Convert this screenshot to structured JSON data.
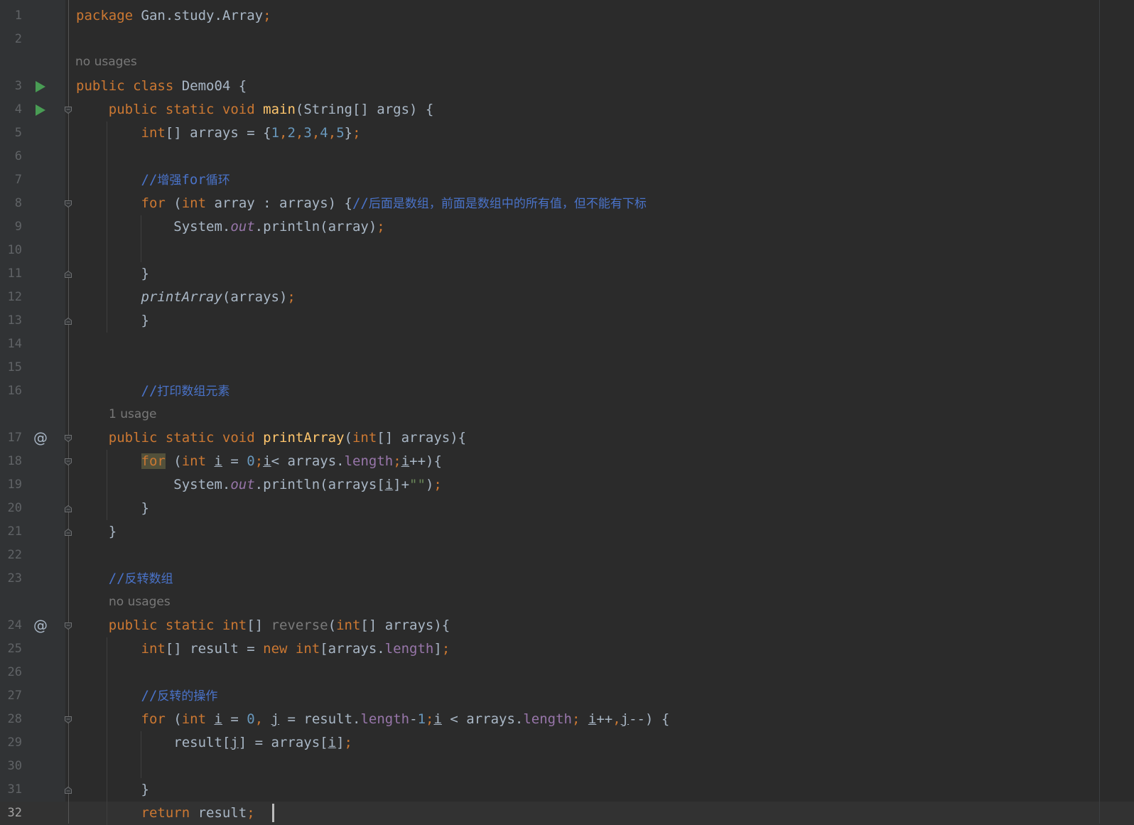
{
  "lines": [
    {
      "n": "1",
      "tokens": [
        {
          "t": "package",
          "c": "kw"
        },
        {
          "t": " Gan.study.Array"
        },
        {
          "t": ";",
          "c": "kw"
        }
      ]
    },
    {
      "n": "2",
      "tokens": []
    },
    {
      "n": "3",
      "tokens": [
        {
          "t": "public class",
          "c": "kw"
        },
        {
          "t": " Demo04 {"
        }
      ]
    },
    {
      "n": "4",
      "tokens": [
        {
          "t": "    public static void",
          "c": "kw"
        },
        {
          "t": " "
        },
        {
          "t": "main",
          "c": "fn"
        },
        {
          "t": "(String[] args) {"
        }
      ]
    },
    {
      "n": "5",
      "tokens": [
        {
          "t": "        int",
          "c": "kw"
        },
        {
          "t": "[] arrays = {"
        },
        {
          "t": "1",
          "c": "num"
        },
        {
          "t": ",",
          "c": "kw"
        },
        {
          "t": "2",
          "c": "num"
        },
        {
          "t": ",",
          "c": "kw"
        },
        {
          "t": "3",
          "c": "num"
        },
        {
          "t": ",",
          "c": "kw"
        },
        {
          "t": "4",
          "c": "num"
        },
        {
          "t": ",",
          "c": "kw"
        },
        {
          "t": "5",
          "c": "num"
        },
        {
          "t": "}"
        },
        {
          "t": ";",
          "c": "kw"
        }
      ]
    },
    {
      "n": "6",
      "tokens": []
    },
    {
      "n": "7",
      "tokens": [
        {
          "t": "        //",
          "c": "cm"
        },
        {
          "t": "增强",
          "c": "cm cm-cjk"
        },
        {
          "t": "for",
          "c": "cm"
        },
        {
          "t": "循环",
          "c": "cm cm-cjk"
        }
      ]
    },
    {
      "n": "8",
      "tokens": [
        {
          "t": "        for",
          "c": "kw"
        },
        {
          "t": " ("
        },
        {
          "t": "int",
          "c": "kw"
        },
        {
          "t": " array : arrays) {"
        },
        {
          "t": "//",
          "c": "cm"
        },
        {
          "t": "后面是数组，前面是数组中的所有值，但不能有下标",
          "c": "cm cm-cjk"
        }
      ]
    },
    {
      "n": "9",
      "tokens": [
        {
          "t": "            System."
        },
        {
          "t": "out",
          "c": "sfld"
        },
        {
          "t": ".println(array)"
        },
        {
          "t": ";",
          "c": "kw"
        }
      ]
    },
    {
      "n": "10",
      "tokens": []
    },
    {
      "n": "11",
      "tokens": [
        {
          "t": "        }"
        }
      ]
    },
    {
      "n": "12",
      "tokens": [
        {
          "t": "        "
        },
        {
          "t": "printArray",
          "c": "ital"
        },
        {
          "t": "(arrays)"
        },
        {
          "t": ";",
          "c": "kw"
        }
      ]
    },
    {
      "n": "13",
      "tokens": [
        {
          "t": "        }"
        }
      ]
    },
    {
      "n": "14",
      "tokens": []
    },
    {
      "n": "15",
      "tokens": []
    },
    {
      "n": "16",
      "tokens": [
        {
          "t": "        //",
          "c": "cm"
        },
        {
          "t": "打印数组元素",
          "c": "cm cm-cjk"
        }
      ],
      "hint_after": "1 usage"
    },
    {
      "n": "17",
      "tokens": [
        {
          "t": "    public static void",
          "c": "kw"
        },
        {
          "t": " "
        },
        {
          "t": "printArray",
          "c": "fn"
        },
        {
          "t": "("
        },
        {
          "t": "int",
          "c": "kw"
        },
        {
          "t": "[] arrays){"
        }
      ]
    },
    {
      "n": "18",
      "tokens": [
        {
          "t": "        "
        },
        {
          "t": "for",
          "c": "kw hl"
        },
        {
          "t": " ("
        },
        {
          "t": "int",
          "c": "kw"
        },
        {
          "t": " "
        },
        {
          "t": "i",
          "c": "ul"
        },
        {
          "t": " = "
        },
        {
          "t": "0",
          "c": "num"
        },
        {
          "t": ";",
          "c": "kw"
        },
        {
          "t": "i",
          "c": "ul"
        },
        {
          "t": "< arrays."
        },
        {
          "t": "length",
          "c": "fld"
        },
        {
          "t": ";",
          "c": "kw"
        },
        {
          "t": "i",
          "c": "ul"
        },
        {
          "t": "++){"
        }
      ]
    },
    {
      "n": "19",
      "tokens": [
        {
          "t": "            System."
        },
        {
          "t": "out",
          "c": "sfld"
        },
        {
          "t": ".println(arrays["
        },
        {
          "t": "i",
          "c": "ul"
        },
        {
          "t": "]+"
        },
        {
          "t": "\"\"",
          "c": "str"
        },
        {
          "t": ")"
        },
        {
          "t": ";",
          "c": "kw"
        }
      ]
    },
    {
      "n": "20",
      "tokens": [
        {
          "t": "        }"
        }
      ]
    },
    {
      "n": "21",
      "tokens": [
        {
          "t": "    }"
        }
      ]
    },
    {
      "n": "22",
      "tokens": []
    },
    {
      "n": "23",
      "tokens": [
        {
          "t": "    //",
          "c": "cm"
        },
        {
          "t": "反转数组",
          "c": "cm cm-cjk"
        }
      ],
      "hint_after": "no usages"
    },
    {
      "n": "24",
      "tokens": [
        {
          "t": "    public static int",
          "c": "kw"
        },
        {
          "t": "[] "
        },
        {
          "t": "reverse",
          "c": "unused"
        },
        {
          "t": "("
        },
        {
          "t": "int",
          "c": "kw"
        },
        {
          "t": "[] arrays){"
        }
      ]
    },
    {
      "n": "25",
      "tokens": [
        {
          "t": "        int",
          "c": "kw"
        },
        {
          "t": "[] result = "
        },
        {
          "t": "new int",
          "c": "kw"
        },
        {
          "t": "[arrays."
        },
        {
          "t": "length",
          "c": "fld"
        },
        {
          "t": "]"
        },
        {
          "t": ";",
          "c": "kw"
        }
      ]
    },
    {
      "n": "26",
      "tokens": []
    },
    {
      "n": "27",
      "tokens": [
        {
          "t": "        //",
          "c": "cm"
        },
        {
          "t": "反转的操作",
          "c": "cm cm-cjk"
        }
      ]
    },
    {
      "n": "28",
      "tokens": [
        {
          "t": "        for",
          "c": "kw"
        },
        {
          "t": " ("
        },
        {
          "t": "int",
          "c": "kw"
        },
        {
          "t": " "
        },
        {
          "t": "i",
          "c": "ul"
        },
        {
          "t": " = "
        },
        {
          "t": "0",
          "c": "num"
        },
        {
          "t": ", ",
          "c": "kw"
        },
        {
          "t": "j",
          "c": "ul"
        },
        {
          "t": " = result."
        },
        {
          "t": "length",
          "c": "fld"
        },
        {
          "t": "-"
        },
        {
          "t": "1",
          "c": "num"
        },
        {
          "t": ";",
          "c": "kw"
        },
        {
          "t": "i",
          "c": "ul"
        },
        {
          "t": " < arrays."
        },
        {
          "t": "length",
          "c": "fld"
        },
        {
          "t": "; ",
          "c": "kw"
        },
        {
          "t": "i",
          "c": "ul"
        },
        {
          "t": "++"
        },
        {
          "t": ",",
          "c": "kw"
        },
        {
          "t": "j",
          "c": "ul"
        },
        {
          "t": "--) {"
        }
      ]
    },
    {
      "n": "29",
      "tokens": [
        {
          "t": "            result["
        },
        {
          "t": "j",
          "c": "ul"
        },
        {
          "t": "] = arrays["
        },
        {
          "t": "i",
          "c": "ul"
        },
        {
          "t": "]"
        },
        {
          "t": ";",
          "c": "kw"
        }
      ]
    },
    {
      "n": "30",
      "tokens": []
    },
    {
      "n": "31",
      "tokens": [
        {
          "t": "        }"
        }
      ]
    },
    {
      "n": "32",
      "tokens": [
        {
          "t": "        return",
          "c": "kw"
        },
        {
          "t": " result"
        },
        {
          "t": ";",
          "c": "kw"
        },
        {
          "t": " "
        }
      ]
    }
  ],
  "inlay_hints": {
    "before_line_3": "no usages"
  },
  "gutter_icons": {
    "run": [
      "3",
      "4"
    ],
    "implemented": [
      "17",
      "24"
    ],
    "fold_open": [
      "4",
      "8",
      "17",
      "18",
      "24",
      "28"
    ],
    "fold_close": [
      "11",
      "13",
      "20",
      "21",
      "31"
    ],
    "implemented_glyph": "@"
  },
  "current_line": "32",
  "colors": {
    "background": "#2b2b2b",
    "gutter": "#313335",
    "keyword": "#cc7832",
    "number": "#6897bb",
    "comment": "#4a73c9",
    "field": "#9876aa",
    "method_decl": "#ffc66d",
    "run_icon": "#499c54"
  }
}
